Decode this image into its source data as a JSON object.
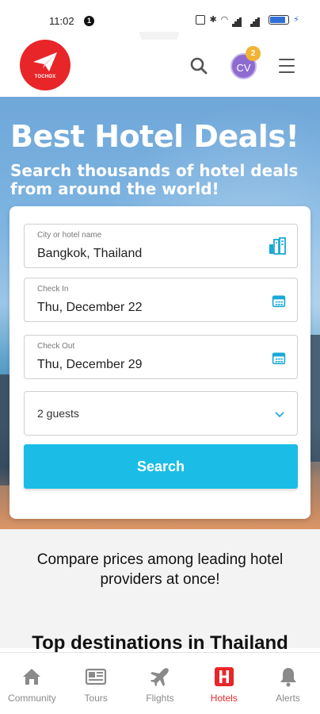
{
  "status_bar": {
    "time": "11:02",
    "notification_count": "1"
  },
  "header": {
    "logo_text": "TOCHOX",
    "avatar_initials": "CV",
    "notification_badge": "2",
    "brand_color": "#e8262a"
  },
  "hero": {
    "title": "Best Hotel Deals!",
    "subtitle": "Search thousands of hotel deals from around the world!"
  },
  "search_form": {
    "city_label": "City or hotel name",
    "city_value": "Bangkok, Thailand",
    "checkin_label": "Check In",
    "checkin_value": "Thu, December 22",
    "checkout_label": "Check Out",
    "checkout_value": "Thu, December 29",
    "guests_value": "2 guests",
    "search_label": "Search",
    "accent_color": "#1bbde6"
  },
  "content": {
    "compare_text": "Compare prices among leading hotel providers at once!",
    "top_destinations": "Top destinations in Thailand"
  },
  "bottom_nav": {
    "items": [
      {
        "label": "Community",
        "icon": "home-icon"
      },
      {
        "label": "Tours",
        "icon": "newspaper-icon"
      },
      {
        "label": "Flights",
        "icon": "airplane-icon"
      },
      {
        "label": "Hotels",
        "icon": "hotel-icon",
        "active": true
      },
      {
        "label": "Alerts",
        "icon": "bell-icon"
      }
    ]
  }
}
